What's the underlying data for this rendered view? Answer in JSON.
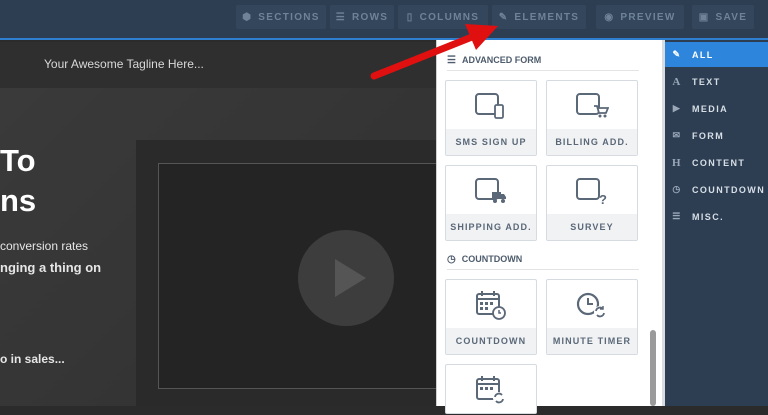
{
  "toolbar": {
    "sections": "SECTIONS",
    "rows": "ROWS",
    "columns": "COLUMNS",
    "elements": "ELEMENTS",
    "preview": "PREVIEW",
    "save": "SAVE"
  },
  "page": {
    "tagline": "Your Awesome Tagline Here...",
    "headline_1": "To",
    "headline_2": "ns",
    "body_1": "conversion rates",
    "body_2": "nging a thing on",
    "body_3": "o in sales..."
  },
  "panel": {
    "section_advanced_form": "ADVANCED FORM",
    "section_countdown": "COUNTDOWN",
    "tiles": {
      "sms_sign_up": "SMS SIGN UP",
      "billing_add": "BILLING ADD.",
      "shipping_add": "SHIPPING ADD.",
      "survey": "SURVEY",
      "countdown": "COUNTDOWN",
      "minute_timer": "MINUTE TIMER"
    }
  },
  "sidebar": {
    "all": "ALL",
    "text": "TEXT",
    "media": "MEDIA",
    "form": "FORM",
    "content": "CONTENT",
    "countdown": "COUNTDOWN",
    "misc": "MISC."
  },
  "colors": {
    "accent": "#2d86dc",
    "toolbar_bg": "#2d3e53",
    "arrow": "#e01010"
  },
  "icons": [
    "sections-icon",
    "rows-icon",
    "columns-icon",
    "elements-icon",
    "preview-icon",
    "save-icon",
    "list-icon",
    "clock-icon",
    "phone-icon",
    "cart-icon",
    "truck-icon",
    "question-icon",
    "calendar-clock-icon",
    "timer-refresh-icon",
    "calendar-refresh-icon",
    "play-icon"
  ]
}
